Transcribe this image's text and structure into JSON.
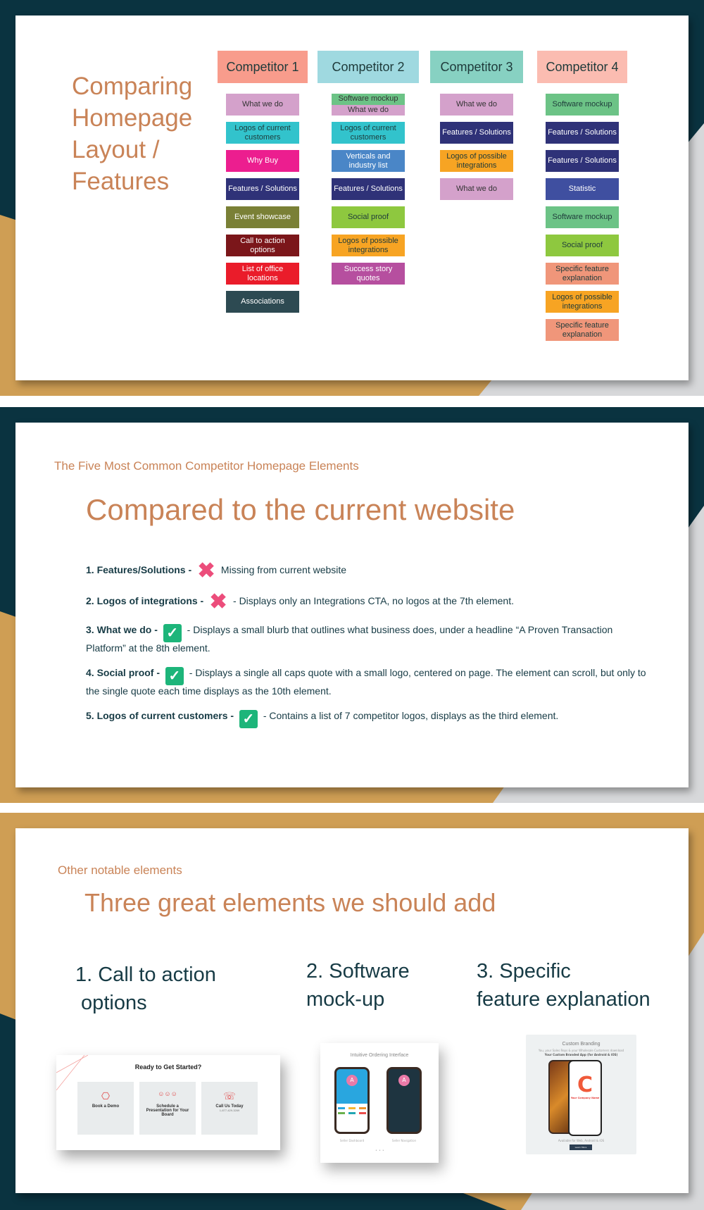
{
  "colors": {
    "navy": "#0a3340",
    "gold": "#cf9e54",
    "title_orange": "#c98357",
    "text_dark": "#173b45",
    "check_green": "#1db57a",
    "cross_pink": "#ec4d7b"
  },
  "slide1": {
    "title": "Comparing Homepage Layout / Features",
    "title_lines": [
      "Comparing",
      "Homepage",
      "Layout /",
      "Features"
    ],
    "competitors": [
      {
        "name": "Competitor 1",
        "header_color": "#f89c8c",
        "elements": [
          {
            "label": "What we do",
            "bg": "#d4a1cb",
            "fg": "#333333"
          },
          {
            "label": "Logos of current customers",
            "lines": [
              "Logos of current",
              "customers"
            ],
            "bg": "#32c3cc",
            "fg": "#1e3a3a"
          },
          {
            "label": "Why Buy",
            "bg": "#ec1e8f",
            "fg": "#ffffff"
          },
          {
            "label": "Features / Solutions",
            "bg": "#2f3278",
            "fg": "#ffffff"
          },
          {
            "label": "Event showcase",
            "bg": "#7a8036",
            "fg": "#ffffff"
          },
          {
            "label": "Call to action options",
            "lines": [
              "Call to action",
              "options"
            ],
            "bg": "#7b161a",
            "fg": "#ffffff"
          },
          {
            "label": "List of office locations",
            "lines": [
              "List of office",
              "locations"
            ],
            "bg": "#ea1c2a",
            "fg": "#ffffff"
          },
          {
            "label": "Associations",
            "bg": "#2d4a52",
            "fg": "#ffffff"
          }
        ]
      },
      {
        "name": "Competitor 2",
        "header_color": "#9fd9e0",
        "elements": [
          {
            "label": "Software mockup / What we do",
            "split": [
              {
                "label": "Software mockup",
                "bg": "#6cc386"
              },
              {
                "label": "What we do",
                "bg": "#d4a1cb"
              }
            ],
            "fg": "#333333"
          },
          {
            "label": "Logos of current customers",
            "lines": [
              "Logos of current",
              "customers"
            ],
            "bg": "#32c3cc",
            "fg": "#1e3a3a"
          },
          {
            "label": "Verticals and industry list",
            "lines": [
              "Verticals and",
              "industry list"
            ],
            "bg": "#4a86c7",
            "fg": "#ffffff"
          },
          {
            "label": "Features / Solutions",
            "bg": "#2f3278",
            "fg": "#ffffff"
          },
          {
            "label": "Social proof",
            "bg": "#8ec83f",
            "fg": "#1e3a3a"
          },
          {
            "label": "Logos of possible integrations",
            "lines": [
              "Logos of possible",
              "integrations"
            ],
            "bg": "#f7a423",
            "fg": "#1e3a3a"
          },
          {
            "label": "Success story quotes",
            "lines": [
              "Success story",
              "quotes"
            ],
            "bg": "#b64f9f",
            "fg": "#ffffff"
          }
        ]
      },
      {
        "name": "Competitor 3",
        "header_color": "#87d1c2",
        "elements": [
          {
            "label": "What we do",
            "bg": "#d4a1cb",
            "fg": "#333333"
          },
          {
            "label": "Features / Solutions",
            "bg": "#2f3278",
            "fg": "#ffffff"
          },
          {
            "label": "Logos of possible integrations",
            "lines": [
              "Logos of possible",
              "integrations"
            ],
            "bg": "#f7a423",
            "fg": "#1e3a3a"
          },
          {
            "label": "What we do",
            "bg": "#d4a1cb",
            "fg": "#333333"
          }
        ]
      },
      {
        "name": "Competitor 4",
        "header_color": "#fbbcb1",
        "elements": [
          {
            "label": "Software mockup",
            "bg": "#6cc386",
            "fg": "#1e3a3a"
          },
          {
            "label": "Features / Solutions",
            "bg": "#2f3278",
            "fg": "#ffffff"
          },
          {
            "label": "Features / Solutions",
            "bg": "#2f3278",
            "fg": "#ffffff"
          },
          {
            "label": "Statistic",
            "bg": "#3f4fa0",
            "fg": "#ffffff"
          },
          {
            "label": "Software mockup",
            "bg": "#6cc386",
            "fg": "#1e3a3a"
          },
          {
            "label": "Social proof",
            "bg": "#8ec83f",
            "fg": "#1e3a3a"
          },
          {
            "label": "Specific feature explanation",
            "lines": [
              "Specific feature",
              "explanation"
            ],
            "bg": "#f0967a",
            "fg": "#1e3a3a"
          },
          {
            "label": "Logos of possible integrations",
            "lines": [
              "Logos of possible",
              "integrations"
            ],
            "bg": "#f7a423",
            "fg": "#1e3a3a"
          },
          {
            "label": "Specific feature explanation",
            "lines": [
              "Specific feature",
              "explanation"
            ],
            "bg": "#f0967a",
            "fg": "#1e3a3a"
          }
        ]
      }
    ]
  },
  "slide2": {
    "subtitle": "The Five Most Common Competitor Homepage Elements",
    "title": "Compared to the current website",
    "criteria": [
      {
        "label": "1. Features/Solutions -",
        "status": "missing",
        "icon": "cross-icon",
        "description": "Missing from current website"
      },
      {
        "label": "2. Logos of integrations -",
        "status": "missing",
        "icon": "cross-icon",
        "description": "- Displays only an Integrations CTA, no logos at the 7th element."
      },
      {
        "label": "3. What we do -",
        "status": "present",
        "icon": "check-icon",
        "description": "- Displays a small blurb that outlines what business does, under a headline “A Proven Transaction Platform” at the 8th element."
      },
      {
        "label": "4. Social proof -",
        "status": "present",
        "icon": "check-icon",
        "description": " - Displays a single all caps quote with a small logo, centered on page. The element can scroll, but only to the single quote each time displays as the 10th element."
      },
      {
        "label": "5. Logos of current customers -",
        "status": "present",
        "icon": "check-icon",
        "description": " - Contains a list of 7 competitor logos, displays as the third element."
      }
    ]
  },
  "slide3": {
    "subtitle": "Other notable elements",
    "title": "Three great elements we should add",
    "items": [
      {
        "lines": [
          "1. Call to action",
          " options"
        ]
      },
      {
        "lines": [
          "2. Software",
          "mock-up"
        ]
      },
      {
        "lines": [
          "3. Specific",
          "feature explanation"
        ]
      }
    ],
    "cta_screenshot": {
      "heading": "Ready to Get Started?",
      "options": [
        {
          "icon": "monitor-icon",
          "glyph": "⎔",
          "label": "Book a Demo",
          "detail": ""
        },
        {
          "icon": "people-icon",
          "glyph": "☺☺☺",
          "label": "Schedule a Presentation for Your Board",
          "detail": ""
        },
        {
          "icon": "phone-icon",
          "glyph": "☏",
          "label": "Call Us Today",
          "detail": "1-877-429-3269"
        }
      ]
    },
    "software_screenshot": {
      "heading": "Intuitive Ordering Interface",
      "captions": [
        "Seller Dashboard",
        "Seller Navigation"
      ]
    },
    "feature_screenshot": {
      "heading": "Custom Branding",
      "subtext": "You, your Sales Reps & your Wholesale Customers download",
      "subtext_bold": "Your Custom Branded App (for Android & iOS)",
      "app_name": "Your Company Name",
      "footnote": "Available for Web, Android & iOS",
      "button": "Learn More"
    }
  }
}
